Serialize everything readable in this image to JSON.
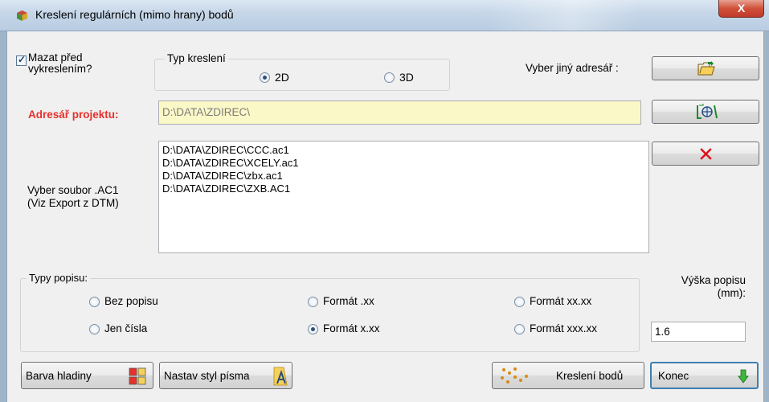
{
  "window": {
    "title": "Kreslení regulárních (mimo hrany) bodů",
    "close_label": "X"
  },
  "options": {
    "erase_before_label": "Mazat před vykreslením?",
    "erase_before_checked": true
  },
  "draw_type": {
    "legend": "Typ kreslení",
    "options": [
      "2D",
      "3D"
    ],
    "selected": "2D"
  },
  "directory": {
    "choose_label": "Vyber jiný adresář :",
    "project_label": "Adresář projektu:",
    "project_value": "D:\\DATA\\ZDIREC\\"
  },
  "file_list": {
    "label_line1": "Vyber soubor .AC1",
    "label_line2": "(Viz Export z DTM)",
    "items": [
      "D:\\DATA\\ZDIREC\\CCC.ac1",
      "D:\\DATA\\ZDIREC\\XCELY.ac1",
      "D:\\DATA\\ZDIREC\\zbx.ac1",
      "D:\\DATA\\ZDIREC\\ZXB.AC1"
    ]
  },
  "label_types": {
    "legend": "Typy popisu:",
    "options": [
      "Bez popisu",
      "Formát .xx",
      "Formát xx.xx",
      "Jen čísla",
      "Formát x.xx",
      "Formát xxx.xx"
    ],
    "selected": "Formát x.xx"
  },
  "label_height": {
    "label_line1": "Výška popisu",
    "label_line2": "(mm):",
    "value": "1.6"
  },
  "buttons": {
    "layer_color": "Barva hladiny",
    "font_style": "Nastav styl písma",
    "draw_points": "Kreslení bodů",
    "end": "Konec"
  },
  "colors": {
    "project_label": "#e8302a",
    "project_field_bg": "#fbf8c7",
    "delete_red": "#e0101a"
  },
  "icons": [
    "app-icon",
    "open-folder-icon",
    "locate-folder-icon",
    "delete-x-icon",
    "color-palette-icon",
    "font-style-icon",
    "points-icon",
    "exit-arrow-icon"
  ]
}
